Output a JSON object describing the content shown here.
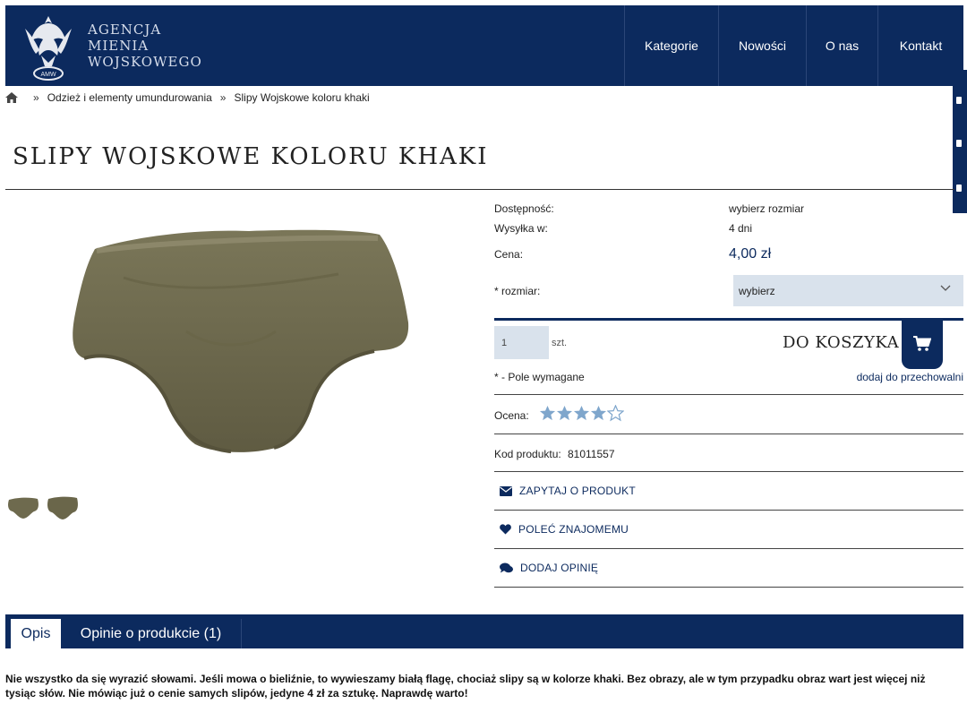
{
  "brand": {
    "line1": "AGENCJA",
    "line2": "MIENIA",
    "line3": "WOJSKOWEGO",
    "emblem_text": "AMW"
  },
  "nav": {
    "items": [
      "Kategorie",
      "Nowości",
      "O nas",
      "Kontakt"
    ]
  },
  "breadcrumb": {
    "home_icon": "home-icon",
    "separator": "»",
    "items": [
      "Odzież i elementy umundurowania",
      "Slipy Wojskowe koloru khaki"
    ]
  },
  "product": {
    "title": "SLIPY WOJSKOWE KOLORU KHAKI",
    "availability_label": "Dostępność:",
    "availability_value": "wybierz rozmiar",
    "shipping_label": "Wysyłka w:",
    "shipping_value": "4 dni",
    "price_label": "Cena:",
    "price_value": "4,00 zł",
    "size_label": "* rozmiar:",
    "size_selected": "wybierz",
    "quantity_value": "1",
    "quantity_unit": "szt.",
    "add_to_cart": "DO KOSZYKA",
    "required_note": "* - Pole wymagane",
    "add_to_storage": "dodaj do przechowalni",
    "rating_label": "Ocena:",
    "rating_value": 4,
    "rating_max": 5,
    "code_label": "Kod produktu:",
    "code_value": "81011557"
  },
  "actions": {
    "ask": "ZAPYTAJ O PRODUKT",
    "recommend": "POLEĆ ZNAJOMEMU",
    "review": "DODAJ OPINIĘ"
  },
  "tabs": {
    "description": "Opis",
    "reviews": "Opinie o produkcie (1)"
  },
  "description_text": "Nie wszystko da się wyrazić słowami. Jeśli mowa o bieliźnie, to wywieszamy białą flagę, chociaż slipy są w kolorze khaki. Bez obrazy, ale w tym przypadku obraz wart jest więcej niż tysiąc słów. Nie mówiąc już o cenie samych slipów, jedyne 4 zł za sztukę. Naprawdę warto!",
  "colors": {
    "navy": "#0c2a5e",
    "khaki": "#6e6a4e",
    "star_fill": "#7fa6cc",
    "select_bg": "#d9e2ec"
  }
}
